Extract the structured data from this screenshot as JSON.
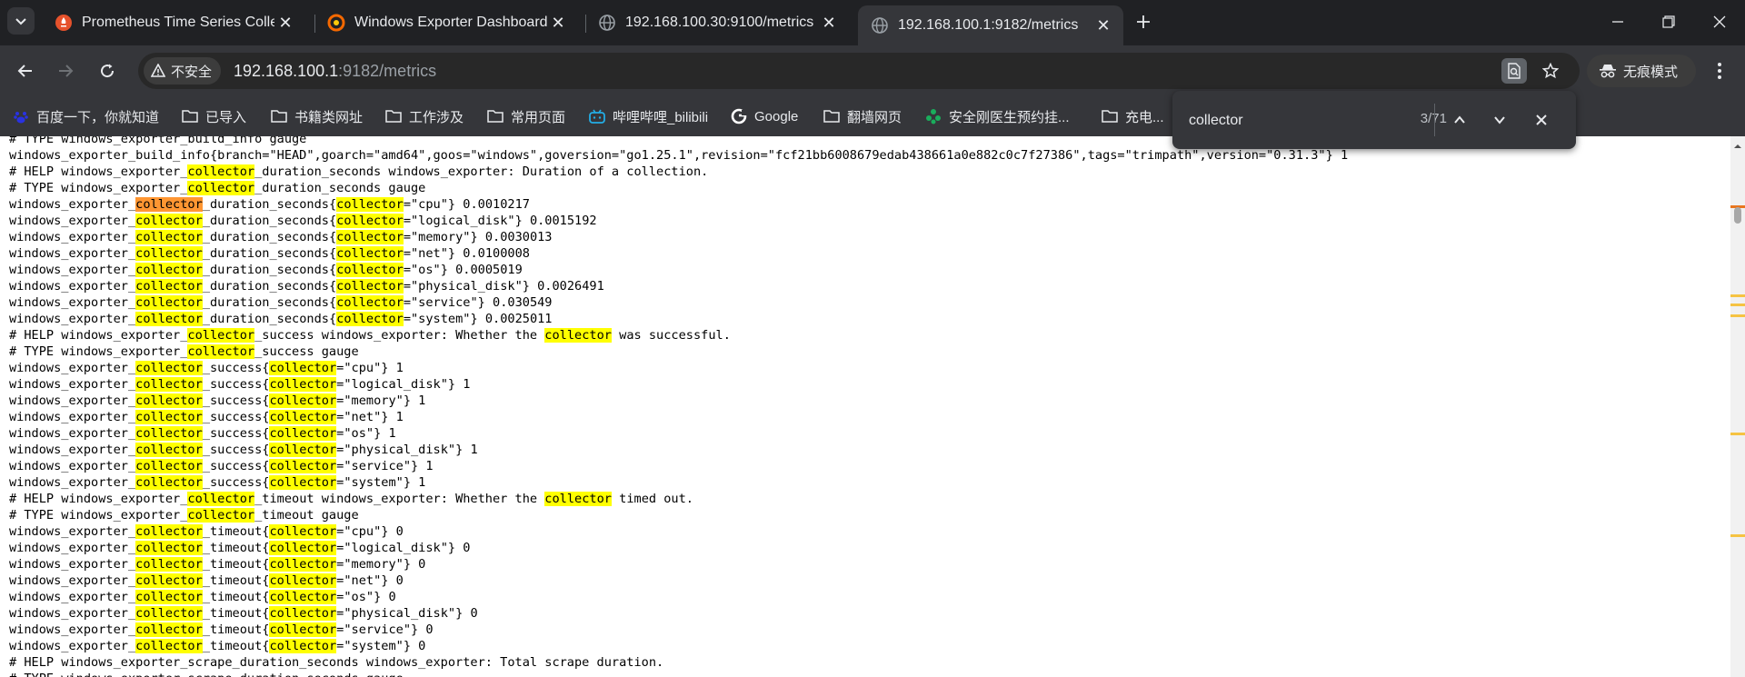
{
  "browser": {
    "tabs": [
      {
        "title": "Prometheus Time Series Colle",
        "icon": "prometheus-icon",
        "active": false
      },
      {
        "title": "Windows Exporter Dashboard",
        "icon": "grafana-icon",
        "active": false
      },
      {
        "title": "192.168.100.30:9100/metrics",
        "icon": "globe-icon",
        "active": false
      },
      {
        "title": "192.168.100.1:9182/metrics",
        "icon": "globe-icon",
        "active": true
      }
    ],
    "security_label": "不安全",
    "url_host": "192.168.100.1",
    "url_rest": ":9182/metrics",
    "incognito_label": "无痕模式",
    "bookmarks": [
      {
        "label": "百度一下，你就知道",
        "icon": "baidu-icon"
      },
      {
        "label": "已导入",
        "icon": "folder-icon"
      },
      {
        "label": "书籍类网址",
        "icon": "folder-icon"
      },
      {
        "label": "工作涉及",
        "icon": "folder-icon"
      },
      {
        "label": "常用页面",
        "icon": "folder-icon"
      },
      {
        "label": "哔哩哔哩_bilibili",
        "icon": "bilibili-icon"
      },
      {
        "label": "Google",
        "icon": "google-icon"
      },
      {
        "label": "翻墙网页",
        "icon": "folder-icon"
      },
      {
        "label": "安全刚医生预约挂...",
        "icon": "health-icon"
      },
      {
        "label": "充电...",
        "icon": "folder-icon"
      }
    ],
    "find": {
      "query": "collector",
      "count": "3/71"
    }
  },
  "colors": {
    "highlight": "#ffff00",
    "current_highlight": "#ff9632",
    "chrome_dark": "#202124",
    "chrome_toolbar": "#35363a"
  },
  "page": {
    "search_term": "collector",
    "current_match_line": 4,
    "lines": [
      "# TYPE windows_exporter_build_info gauge",
      "windows_exporter_build_info{branch=\"HEAD\",goarch=\"amd64\",goos=\"windows\",goversion=\"go1.25.1\",revision=\"fcf21bb6008679edab438661a0e882c0c7f27386\",tags=\"trimpath\",version=\"0.31.3\"} 1",
      "# HELP windows_exporter_collector_duration_seconds windows_exporter: Duration of a collection.",
      "# TYPE windows_exporter_collector_duration_seconds gauge",
      "windows_exporter_collector_duration_seconds{collector=\"cpu\"} 0.0010217",
      "windows_exporter_collector_duration_seconds{collector=\"logical_disk\"} 0.0015192",
      "windows_exporter_collector_duration_seconds{collector=\"memory\"} 0.0030013",
      "windows_exporter_collector_duration_seconds{collector=\"net\"} 0.0100008",
      "windows_exporter_collector_duration_seconds{collector=\"os\"} 0.0005019",
      "windows_exporter_collector_duration_seconds{collector=\"physical_disk\"} 0.0026491",
      "windows_exporter_collector_duration_seconds{collector=\"service\"} 0.030549",
      "windows_exporter_collector_duration_seconds{collector=\"system\"} 0.0025011",
      "# HELP windows_exporter_collector_success windows_exporter: Whether the collector was successful.",
      "# TYPE windows_exporter_collector_success gauge",
      "windows_exporter_collector_success{collector=\"cpu\"} 1",
      "windows_exporter_collector_success{collector=\"logical_disk\"} 1",
      "windows_exporter_collector_success{collector=\"memory\"} 1",
      "windows_exporter_collector_success{collector=\"net\"} 1",
      "windows_exporter_collector_success{collector=\"os\"} 1",
      "windows_exporter_collector_success{collector=\"physical_disk\"} 1",
      "windows_exporter_collector_success{collector=\"service\"} 1",
      "windows_exporter_collector_success{collector=\"system\"} 1",
      "# HELP windows_exporter_collector_timeout windows_exporter: Whether the collector timed out.",
      "# TYPE windows_exporter_collector_timeout gauge",
      "windows_exporter_collector_timeout{collector=\"cpu\"} 0",
      "windows_exporter_collector_timeout{collector=\"logical_disk\"} 0",
      "windows_exporter_collector_timeout{collector=\"memory\"} 0",
      "windows_exporter_collector_timeout{collector=\"net\"} 0",
      "windows_exporter_collector_timeout{collector=\"os\"} 0",
      "windows_exporter_collector_timeout{collector=\"physical_disk\"} 0",
      "windows_exporter_collector_timeout{collector=\"service\"} 0",
      "windows_exporter_collector_timeout{collector=\"system\"} 0",
      "# HELP windows_exporter_scrape_duration_seconds windows_exporter: Total scrape duration.",
      "# TYPE windows_exporter_scrape_duration_seconds gauge"
    ]
  }
}
